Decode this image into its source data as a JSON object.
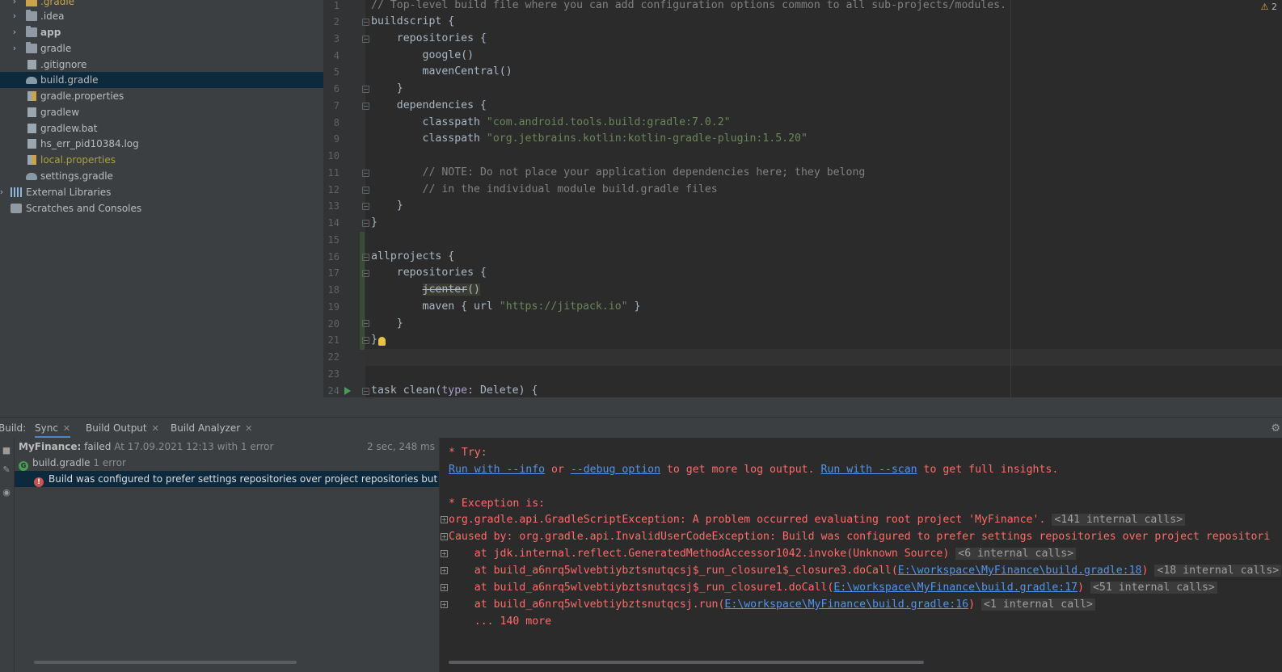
{
  "project_tree": {
    "items": [
      {
        "label": ".gradle",
        "icon": "folder-icon",
        "color": "#c9a44b",
        "expandable": true
      },
      {
        "label": ".idea",
        "icon": "folder-icon",
        "color": "#bbbbbb",
        "expandable": true
      },
      {
        "label": "app",
        "icon": "module-folder-icon",
        "color": "#bbbbbb",
        "expandable": true
      },
      {
        "label": "gradle",
        "icon": "folder-icon",
        "color": "#bbbbbb",
        "expandable": true
      },
      {
        "label": ".gitignore",
        "icon": "file-icon",
        "color": "#bbbbbb"
      },
      {
        "label": "build.gradle",
        "icon": "gradle-icon",
        "color": "#bbbbbb",
        "selected": true
      },
      {
        "label": "gradle.properties",
        "icon": "properties-icon",
        "color": "#bbbbbb"
      },
      {
        "label": "gradlew",
        "icon": "file-icon",
        "color": "#bbbbbb"
      },
      {
        "label": "gradlew.bat",
        "icon": "file-icon",
        "color": "#bbbbbb"
      },
      {
        "label": "hs_err_pid10384.log",
        "icon": "log-file-icon",
        "color": "#bbbbbb"
      },
      {
        "label": "local.properties",
        "icon": "properties-icon",
        "color": "#a8a33a"
      },
      {
        "label": "settings.gradle",
        "icon": "gradle-icon",
        "color": "#bbbbbb"
      },
      {
        "label": "External Libraries",
        "icon": "libraries-icon",
        "color": "#bbbbbb",
        "expandable": true
      },
      {
        "label": "Scratches and Consoles",
        "icon": "scratches-icon",
        "color": "#bbbbbb"
      }
    ]
  },
  "editor": {
    "warning_count": "2",
    "line_numbers": [
      "1",
      "2",
      "3",
      "4",
      "5",
      "6",
      "7",
      "8",
      "9",
      "10",
      "11",
      "12",
      "13",
      "14",
      "15",
      "16",
      "17",
      "18",
      "19",
      "20",
      "21",
      "22",
      "23",
      "24"
    ],
    "lines": {
      "l1": "// Top-level build file where you can add configuration options common to all sub-projects/modules.",
      "l2": "buildscript {",
      "l3": "    repositories {",
      "l4": "        google()",
      "l5": "        mavenCentral()",
      "l6": "    }",
      "l7": "    dependencies {",
      "l8a": "        classpath ",
      "l8b": "\"com.android.tools.build:gradle:7.0.2\"",
      "l9a": "        classpath ",
      "l9b": "\"org.jetbrains.kotlin:kotlin-gradle-plugin:1.5.20\"",
      "l10": "",
      "l11": "        // NOTE: Do not place your application dependencies here; they belong",
      "l12": "        // in the individual module build.gradle files",
      "l13": "    }",
      "l14": "}",
      "l15": "",
      "l16": "allprojects {",
      "l17": "    repositories {",
      "l18a": "        ",
      "l18b": "jcenter",
      "l18c": "()",
      "l19a": "        maven { url ",
      "l19b": "\"https://jitpack.io\"",
      "l19c": " }",
      "l20": "    }",
      "l21": "}",
      "l22": "",
      "l23": "",
      "l24a": "task clean(",
      "l24b": "type",
      "l24c": ": Delete) {"
    }
  },
  "build": {
    "label": "Build:",
    "tabs": {
      "sync": "Sync",
      "build_output": "Build Output",
      "build_analyzer": "Build Analyzer"
    },
    "tree": {
      "root_name": "MyFinance:",
      "root_status": " failed",
      "root_detail": " At 17.09.2021 12:13 with 1 error",
      "root_time": "2 sec, 248 ms",
      "file_name": "build.gradle",
      "file_detail": " 1 error",
      "error_text": "Build was configured to prefer settings repositories over project repositories but repository 'Bi"
    },
    "console": {
      "try": "* Try:",
      "run_info_link": "Run with --info",
      "or": " or ",
      "debug_link": "--debug option",
      "more_log": " to get more log output. ",
      "scan_link": "Run with --scan",
      "insights": " to get full insights.",
      "exception": "* Exception is:",
      "ex1": "org.gradle.api.GradleScriptException: A problem occurred evaluating root project 'MyFinance'.",
      "ex1_internal": "<141 internal calls>",
      "ex2": "Caused by: org.gradle.api.InvalidUserCodeException: Build was configured to prefer settings repositories over project repositori",
      "st1": "    at jdk.internal.reflect.GeneratedMethodAccessor1042.invoke(Unknown Source)",
      "st1_internal": "<6 internal calls>",
      "st2": "    at build_a6nrq5wlvebtiybztsnutqcsj$_run_closure1$_closure3.doCall(",
      "st2_link": "E:\\workspace\\MyFinance\\build.gradle:18",
      "st2_internal": "<18 internal calls>",
      "st3": "    at build_a6nrq5wlvebtiybztsnutqcsj$_run_closure1.doCall(",
      "st3_link": "E:\\workspace\\MyFinance\\build.gradle:17",
      "st3_internal": "<51 internal calls>",
      "st4": "    at build_a6nrq5wlvebtiybztsnutqcsj.run(",
      "st4_link": "E:\\workspace\\MyFinance\\build.gradle:16",
      "st4_internal": "<1 internal call>",
      "more": "    ... 140 more",
      "close_paren": ")"
    }
  }
}
